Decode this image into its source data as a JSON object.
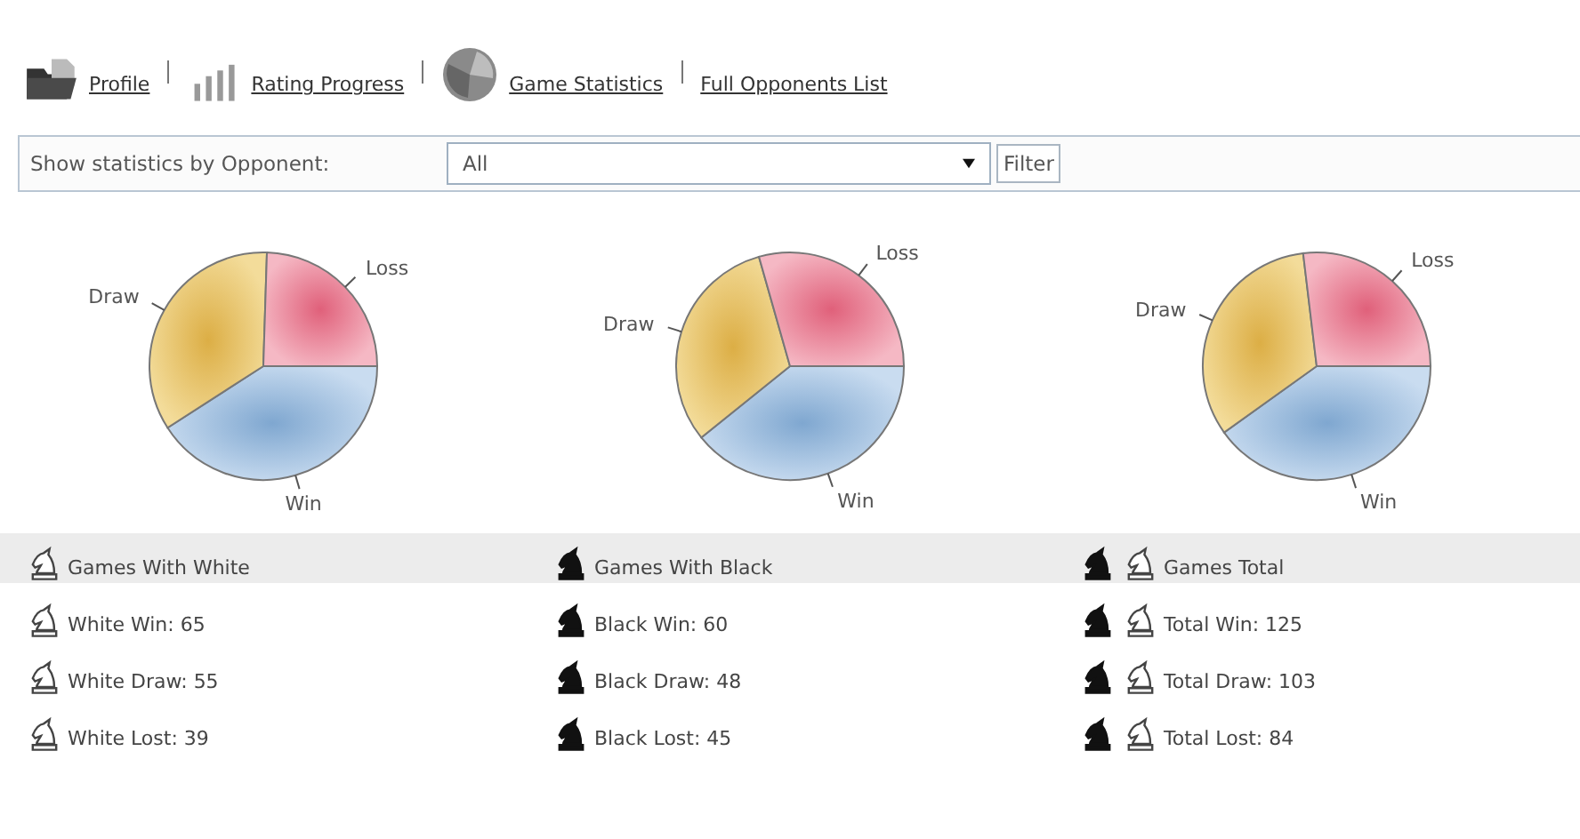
{
  "nav": [
    {
      "kind": "folder",
      "label": "Profile"
    },
    {
      "kind": "bars",
      "label": "Rating Progress"
    },
    {
      "kind": "pie",
      "label": "Game Statistics"
    },
    {
      "kind": "none",
      "label": "Full Opponents List"
    }
  ],
  "filter": {
    "label": "Show statistics by Opponent:",
    "value": "All",
    "button": "Filter"
  },
  "columns": [
    {
      "kind": "white",
      "chart_data": {
        "type": "pie",
        "categories": [
          "Win",
          "Draw",
          "Loss"
        ],
        "values": [
          40.9,
          34.6,
          24.5
        ]
      },
      "title": "Games With White",
      "stats": [
        "White Win: 65",
        "White Draw: 55",
        "White Lost: 39"
      ]
    },
    {
      "kind": "black",
      "chart_data": {
        "type": "pie",
        "categories": [
          "Win",
          "Draw",
          "Loss"
        ],
        "values": [
          39.2,
          31.4,
          29.4
        ]
      },
      "title": "Games With Black",
      "stats": [
        "Black Win: 60",
        "Black Draw: 48",
        "Black Lost: 45"
      ]
    },
    {
      "kind": "both",
      "chart_data": {
        "type": "pie",
        "categories": [
          "Win",
          "Draw",
          "Loss"
        ],
        "values": [
          40.1,
          33.0,
          26.9
        ]
      },
      "title": "Games Total",
      "stats": [
        "Total Win: 125",
        "Total Draw: 103",
        "Total Lost: 84"
      ]
    }
  ]
}
